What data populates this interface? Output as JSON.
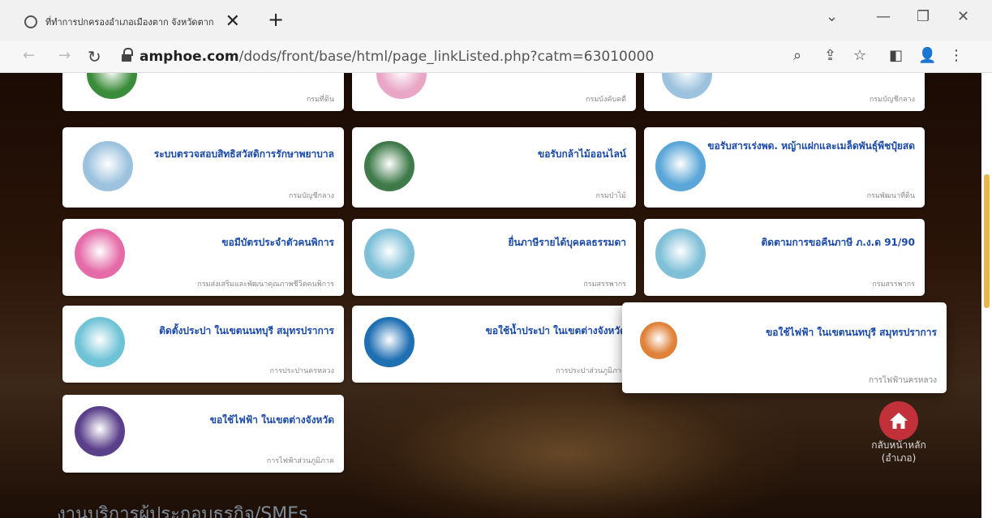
{
  "browser": {
    "tab_title": "ที่ทำการปกครองอำเภอเมืองตาก จังหวัดตาก",
    "tab_close": "✕",
    "new_tab": "+",
    "url_domain": "amphoe.com",
    "url_path": "/dods/front/base/html/page_linkListed.php?catm=63010000"
  },
  "partial_row": [
    {
      "dept": "กรมที่ดิน",
      "color": "#3b8c3a"
    },
    {
      "dept": "กรมบังคับคดี",
      "color": "#e9a6c6"
    },
    {
      "dept": "กรมบัญชีกลาง",
      "color": "#9cc2de"
    }
  ],
  "services": [
    {
      "name": "ระบบตรวจสอบสิทธิสวัสดิการรักษาพยาบาล",
      "dept": "กรมบัญชีกลาง",
      "color": "#9cc2de"
    },
    {
      "name": "ขอรับกล้าไม้ออนไลน์",
      "dept": "กรมป่าไม้",
      "color": "#3f7a4a"
    },
    {
      "name": "ขอรับสารเร่งพด. หญ้าแฝกและเมล็ดพันธุ์พืชปุ๋ยสด",
      "dept": "กรมพัฒนาที่ดิน",
      "color": "#5aa6d8"
    },
    {
      "name": "ขอมีบัตรประจำตัวคนพิการ",
      "dept": "กรมส่งเสริมและพัฒนาคุณภาพชีวิตคนพิการ",
      "color": "#e56aa8"
    },
    {
      "name": "ยื่นภาษีรายได้บุคคลธรรมดา",
      "dept": "กรมสรรพากร",
      "color": "#7fc0d8"
    },
    {
      "name": "ติดตามการขอคืนภาษี ภ.ง.ด 91/90",
      "dept": "กรมสรรพากร",
      "color": "#7fc0d8"
    },
    {
      "name": "ติดตั้งประปา ในเขตนนทบุรี สมุทรปราการ",
      "dept": "การประปานครหลวง",
      "color": "#6fc3d6"
    },
    {
      "name": "ขอใช้น้ำประปา ในเขตต่างจังหวัด",
      "dept": "การประปาส่วนภูมิภาค",
      "color": "#1f6fb3"
    },
    {
      "name": "ขอใช้ไฟฟ้า ในเขตนนทบุรี สมุทรปราการ",
      "dept": "การไฟฟ้านครหลวง",
      "color": "#e0823a"
    },
    {
      "name": "ขอใช้ไฟฟ้า ในเขตต่างจังหวัด",
      "dept": "การไฟฟ้าส่วนภูมิภาค",
      "color": "#5a3f8a"
    }
  ],
  "home": {
    "label_line1": "กลับหน้าหลัก",
    "label_line2": "(อำเภอ)"
  },
  "footer_heading": "งานบริการผู้ประกอบธุรกิจ/SMEs",
  "colors": {
    "link_blue": "#1a4aa8",
    "home_red": "#c2303a",
    "scroll_accent": "#e6b84b"
  }
}
